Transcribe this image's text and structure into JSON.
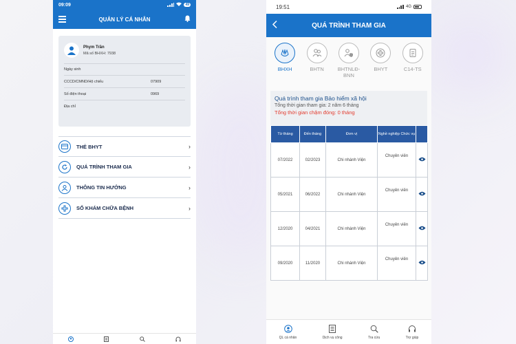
{
  "screen1": {
    "status": {
      "time": "09:09",
      "battery": "49"
    },
    "header_title": "QUẢN LÝ CÁ NHÂN",
    "profile": {
      "name": "Phym Trần",
      "bhxh": "Mã số BHXH: 7938",
      "fields": [
        {
          "label": "Ngày sinh",
          "value": ""
        },
        {
          "label": "CCCD/CMND/Hộ chiếu",
          "value": "07909"
        },
        {
          "label": "Số điện thoại",
          "value": "0969"
        },
        {
          "label": "Địa chỉ",
          "value": ""
        }
      ]
    },
    "menu": [
      {
        "label": "THẺ BHYT",
        "icon": "card-icon"
      },
      {
        "label": "QUÁ TRÌNH THAM GIA",
        "icon": "refresh-icon"
      },
      {
        "label": "THÔNG TIN HƯỞNG",
        "icon": "people-icon"
      },
      {
        "label": "SỔ KHÁM CHỮA BỆNH",
        "icon": "medical-cross-icon"
      }
    ]
  },
  "screen2": {
    "status": {
      "time": "19:51",
      "network": "4G"
    },
    "header_title": "QUÁ TRÌNH THAM GIA",
    "tabs": [
      {
        "label": "BHXH",
        "icon": "hands-icon",
        "active": true
      },
      {
        "label": "BHTN",
        "icon": "people-icon",
        "active": false
      },
      {
        "label": "BHTNLĐ-BNN",
        "icon": "shield-person-icon",
        "active": false
      },
      {
        "label": "BHYT",
        "icon": "medical-cross-icon",
        "active": false
      },
      {
        "label": "C14-TS",
        "icon": "document-icon",
        "active": false
      }
    ],
    "info": {
      "title": "Quá trình tham gia Bảo hiểm xã hội",
      "total": "Tổng thời gian tham gia: 2 năm 6 tháng",
      "late": "Tổng thời gian chậm đóng: 0 tháng"
    },
    "table": {
      "headers": [
        "Từ tháng",
        "Đến tháng",
        "Đơn vị",
        "Nghề nghiệp Chức vụ"
      ],
      "rows": [
        {
          "from": "07/2022",
          "to": "02/2023",
          "unit": "Chi nhánh Viện",
          "job": "Chuyên viên"
        },
        {
          "from": "05/2021",
          "to": "06/2022",
          "unit": "Chi nhánh Viện",
          "job": "Chuyên viên"
        },
        {
          "from": "12/2020",
          "to": "04/2021",
          "unit": "Chi nhánh Viện",
          "job": "Chuyên viên"
        },
        {
          "from": "09/2020",
          "to": "11/2020",
          "unit": "Chi nhánh Viện",
          "job": "Chuyên viên"
        }
      ]
    },
    "bottom_nav": [
      {
        "label": "QL cá nhân",
        "icon": "profile-icon"
      },
      {
        "label": "Dịch vụ công",
        "icon": "document-icon"
      },
      {
        "label": "Tra cứu",
        "icon": "search-icon"
      },
      {
        "label": "Trợ giúp",
        "icon": "headset-icon"
      }
    ]
  },
  "colors": {
    "primary": "#1a73c9",
    "table_header": "#2a5aa3",
    "alert": "#e23b2e"
  }
}
